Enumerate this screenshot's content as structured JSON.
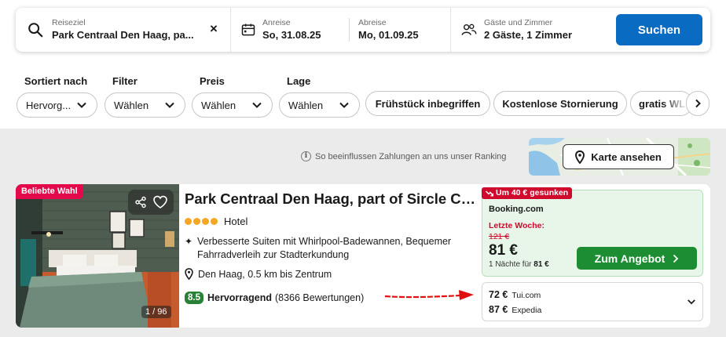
{
  "search": {
    "destination_label": "Reiseziel",
    "destination_value": "Park Centraal Den Haag, pa...",
    "arrival_label": "Anreise",
    "arrival_value": "So, 31.08.25",
    "departure_label": "Abreise",
    "departure_value": "Mo, 01.09.25",
    "guests_label": "Gäste und Zimmer",
    "guests_value": "2 Gäste, 1 Zimmer",
    "search_button": "Suchen",
    "clear_icon": "×"
  },
  "filters": {
    "sort": {
      "label": "Sortiert nach",
      "value": "Hervorg..."
    },
    "filter": {
      "label": "Filter",
      "value": "Wählen"
    },
    "price": {
      "label": "Preis",
      "value": "Wählen"
    },
    "location": {
      "label": "Lage",
      "value": "Wählen"
    },
    "chips": [
      "Frühstück inbegriffen",
      "Kostenlose Stornierung",
      "gratis WL"
    ]
  },
  "results": {
    "ranking_note": "So beeinflussen Zahlungen an uns unser Ranking",
    "map_button": "Karte ansehen"
  },
  "hotel": {
    "badge": "Beliebte Wahl",
    "image_counter": "1 / 96",
    "name": "Park Centraal Den Haag, part of Sircle Coll...",
    "stars": 4,
    "type": "Hotel",
    "feature": "Verbesserte Suiten mit Whirlpool-Badewannen, Bequemer Fahrradverleih zur Stadterkundung",
    "location": "Den Haag, 0.5 km bis Zentrum",
    "rating": {
      "score": "8.5",
      "label": "Hervorragend",
      "reviews": "(8366 Bewertungen)"
    },
    "deal": {
      "drop_badge": "Um 40 € gesunken",
      "provider": "Booking.com",
      "last_week_label": "Letzte Woche:",
      "old_price": "121 €",
      "price": "81 €",
      "nights_prefix": "1 Nächte für",
      "nights_total": "81 €",
      "button": "Zum Angebot"
    },
    "other_prices": [
      {
        "price": "72 €",
        "provider": "Tui.com"
      },
      {
        "price": "87 €",
        "provider": "Expedia"
      }
    ]
  },
  "colors": {
    "search_button": "#0a6bc2",
    "deal_button": "#1d8d33",
    "rating_badge": "#298138",
    "price_drop": "#cf0a2c",
    "popular_badge": "#e3094a",
    "star": "#f5a623",
    "annotation_arrow": "#e01010"
  }
}
